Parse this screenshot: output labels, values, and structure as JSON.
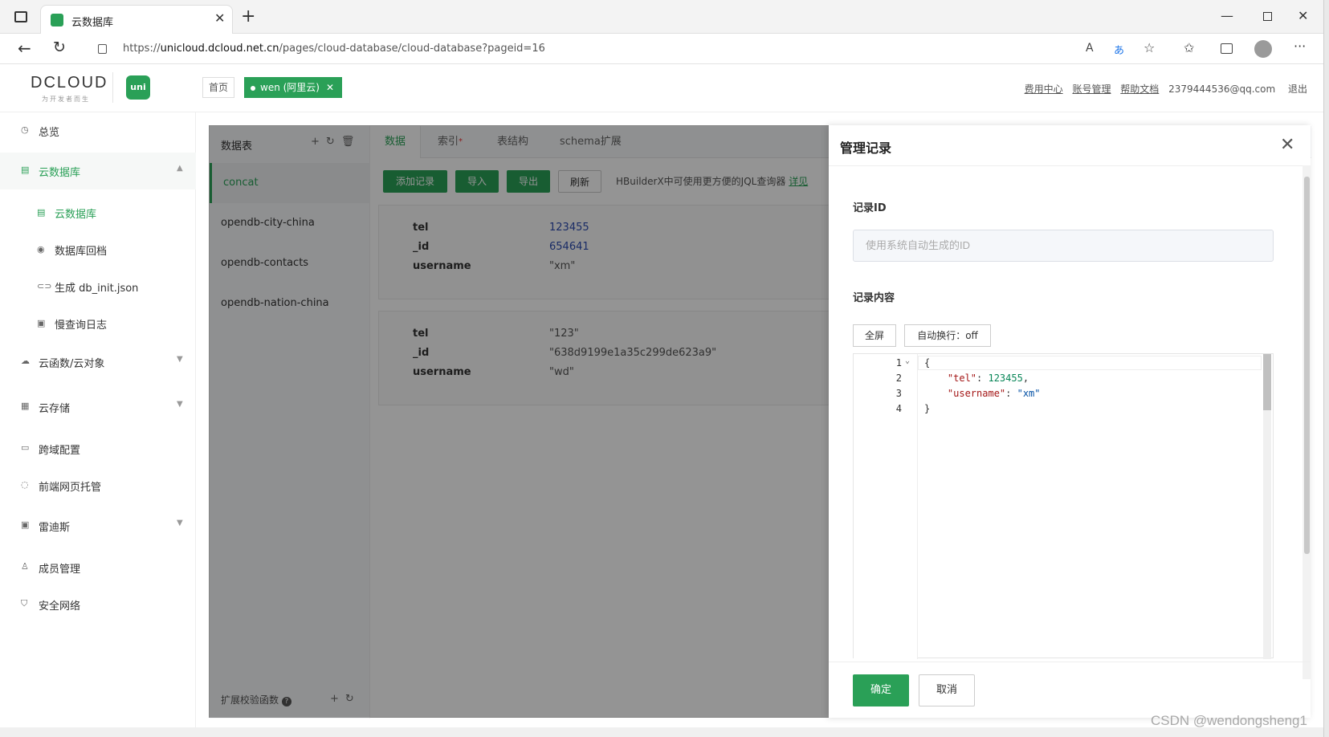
{
  "browser": {
    "tab_title": "云数据库",
    "url_prefix": "https://",
    "url_host": "unicloud.dcloud.net.cn",
    "url_path": "/pages/cloud-database/cloud-database?pageid=16"
  },
  "header": {
    "logo": "DCLOUD",
    "logo_tagline": "为开发者而生",
    "uni_badge": "uni",
    "home_tab": "首页",
    "space_tab": "wen (阿里云)",
    "links": [
      "费用中心",
      "账号管理",
      "帮助文档"
    ],
    "email": "2379444536@qq.com",
    "logout": "退出"
  },
  "sidebar": {
    "items": [
      {
        "label": "总览",
        "icon": "clock-icon"
      },
      {
        "label": "云数据库",
        "icon": "database-icon"
      },
      {
        "label": "云函数/云对象",
        "icon": "cloud-icon"
      },
      {
        "label": "云存储",
        "icon": "storage-icon"
      },
      {
        "label": "跨域配置",
        "icon": "cors-icon"
      },
      {
        "label": "前端网页托管",
        "icon": "hosting-icon"
      },
      {
        "label": "雷迪斯",
        "icon": "redis-icon"
      },
      {
        "label": "成员管理",
        "icon": "user-icon"
      },
      {
        "label": "安全网络",
        "icon": "shield-icon"
      }
    ],
    "subitems": [
      {
        "label": "云数据库"
      },
      {
        "label": "数据库回档"
      },
      {
        "label": "生成 db_init.json"
      },
      {
        "label": "慢查询日志"
      }
    ]
  },
  "tables": {
    "title": "数据表",
    "items": [
      "concat",
      "opendb-city-china",
      "opendb-contacts",
      "opendb-nation-china"
    ],
    "footer": "扩展校验函数"
  },
  "content": {
    "tabs": [
      "数据",
      "索引",
      "表结构",
      "schema扩展"
    ],
    "tab_star": "*",
    "buttons": {
      "add": "添加记录",
      "import": "导入",
      "export": "导出",
      "refresh": "刷新"
    },
    "hint": "HBuilderX中可使用更方便的JQL查询器",
    "hint_link": "详见",
    "records": [
      {
        "fields": [
          {
            "k": "tel",
            "v": "123455"
          },
          {
            "k": "_id",
            "v": "654641"
          },
          {
            "k": "username",
            "v": "\"xm\""
          }
        ]
      },
      {
        "fields": [
          {
            "k": "tel",
            "v": "\"123\""
          },
          {
            "k": "_id",
            "v": "\"638d9199e1a35c299de623a9\""
          },
          {
            "k": "username",
            "v": "\"wd\""
          }
        ]
      }
    ]
  },
  "drawer": {
    "title": "管理记录",
    "id_label": "记录ID",
    "id_placeholder": "使用系统自动生成的ID",
    "content_label": "记录内容",
    "fullscreen": "全屏",
    "wrap": "自动换行：off",
    "code": {
      "line_numbers": [
        "1",
        "2",
        "3",
        "4"
      ],
      "open": "{",
      "l2_key": "\"tel\"",
      "l2_val": "123455",
      "l3_key": "\"username\"",
      "l3_val": "\"xm\"",
      "close": "}"
    },
    "confirm": "确定",
    "cancel": "取消"
  },
  "watermark": "CSDN @wendongsheng1",
  "colors": {
    "accent": "#2aa057",
    "number": "#2b4bb0"
  }
}
